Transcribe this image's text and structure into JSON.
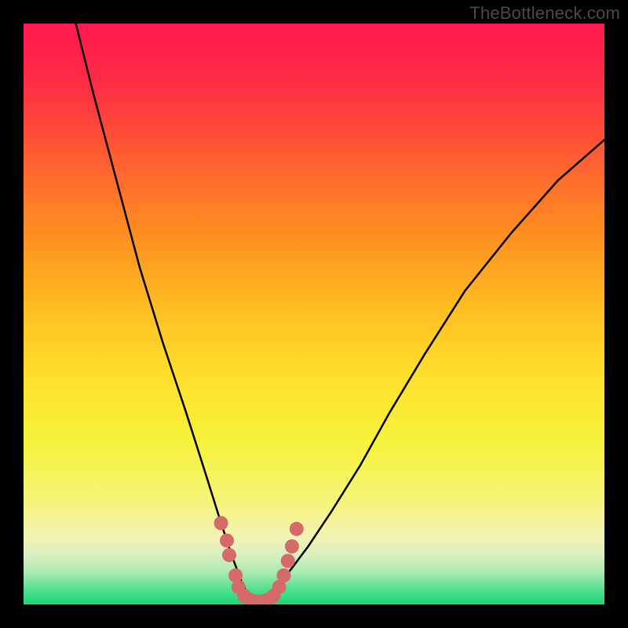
{
  "watermark": "TheBottleneck.com",
  "gradient": {
    "stops": [
      {
        "offset": 0.0,
        "color": "#ff1a4d"
      },
      {
        "offset": 0.1,
        "color": "#ff2b44"
      },
      {
        "offset": 0.22,
        "color": "#ff5a33"
      },
      {
        "offset": 0.35,
        "color": "#ff8a22"
      },
      {
        "offset": 0.48,
        "color": "#ffba22"
      },
      {
        "offset": 0.6,
        "color": "#ffde2a"
      },
      {
        "offset": 0.72,
        "color": "#f7f23a"
      },
      {
        "offset": 0.82,
        "color": "#f4f478"
      },
      {
        "offset": 0.885,
        "color": "#f2f2b4"
      },
      {
        "offset": 0.915,
        "color": "#d9f0c0"
      },
      {
        "offset": 0.945,
        "color": "#a9e9b0"
      },
      {
        "offset": 0.975,
        "color": "#4fe08c"
      },
      {
        "offset": 1.0,
        "color": "#18d874"
      }
    ]
  },
  "chart_data": {
    "type": "line",
    "title": "",
    "xlabel": "",
    "ylabel": "",
    "xlim": [
      0,
      100
    ],
    "ylim": [
      0,
      100
    ],
    "grid": false,
    "series": [
      {
        "name": "bottleneck-curve",
        "x": [
          9,
          12,
          16,
          20,
          24,
          28,
          31.5,
          34,
          36,
          37.5,
          39,
          40.5,
          42,
          43.5,
          46,
          49,
          53,
          58,
          63,
          69,
          76,
          84,
          92,
          100
        ],
        "values": [
          100,
          88,
          73,
          58,
          45,
          33,
          22,
          14,
          8,
          4,
          1,
          0.5,
          1,
          3,
          6,
          10,
          16,
          24,
          33,
          43,
          54,
          64,
          73,
          80
        ]
      }
    ],
    "markers": {
      "name": "highlight-dots",
      "color": "#d46a6a",
      "points": [
        {
          "x": 34.0,
          "y": 14.0
        },
        {
          "x": 35.0,
          "y": 11.0
        },
        {
          "x": 35.4,
          "y": 8.5
        },
        {
          "x": 36.5,
          "y": 5.0
        },
        {
          "x": 37.0,
          "y": 3.0
        },
        {
          "x": 38.0,
          "y": 1.5
        },
        {
          "x": 39.0,
          "y": 0.8
        },
        {
          "x": 40.0,
          "y": 0.5
        },
        {
          "x": 41.0,
          "y": 0.5
        },
        {
          "x": 42.0,
          "y": 0.8
        },
        {
          "x": 43.0,
          "y": 1.5
        },
        {
          "x": 44.0,
          "y": 3.0
        },
        {
          "x": 44.8,
          "y": 5.0
        },
        {
          "x": 45.5,
          "y": 7.5
        },
        {
          "x": 46.2,
          "y": 10.0
        },
        {
          "x": 47.0,
          "y": 13.0
        }
      ]
    }
  }
}
